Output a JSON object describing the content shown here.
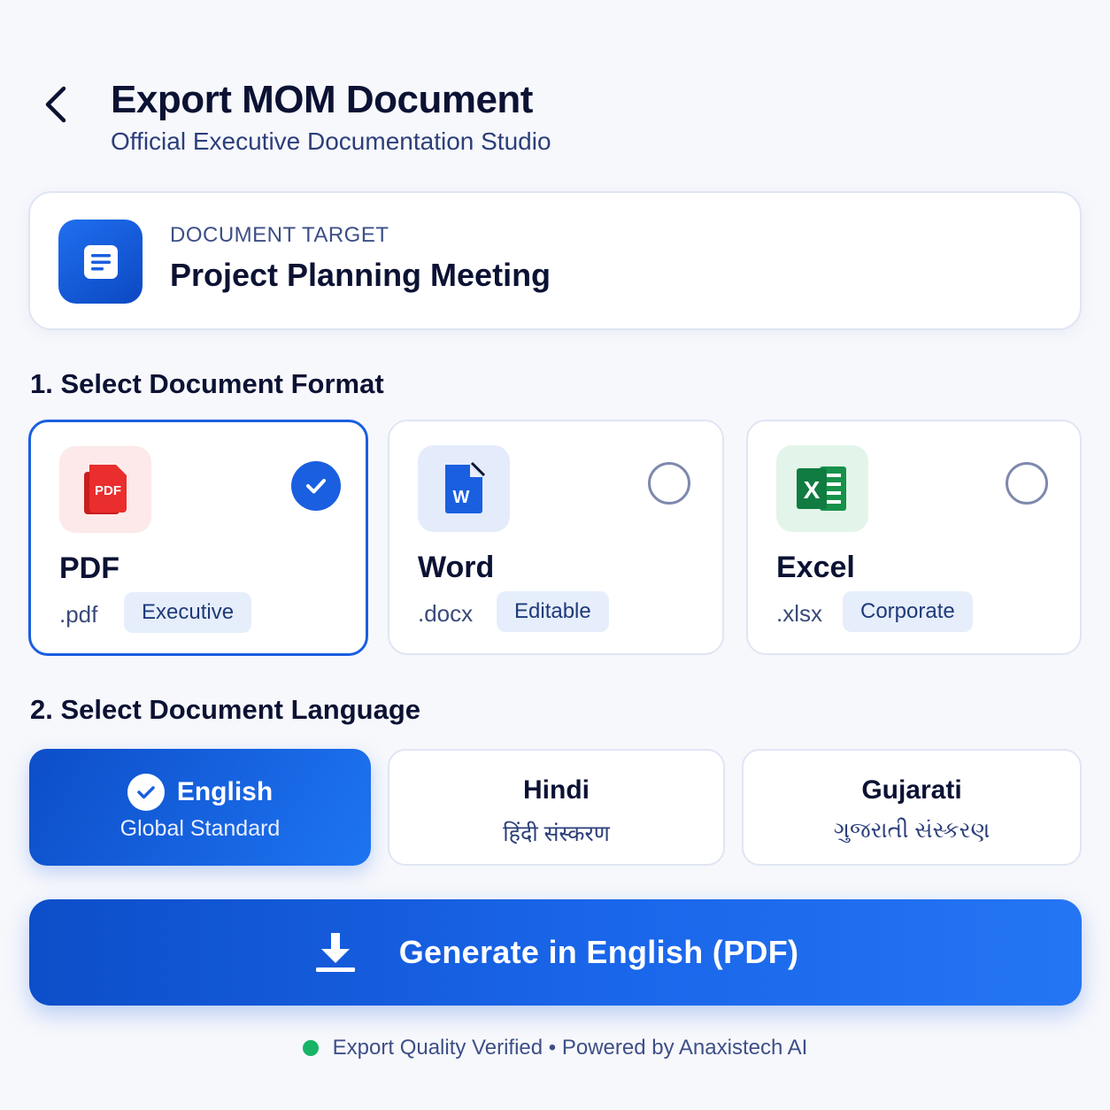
{
  "header": {
    "title": "Export MOM Document",
    "subtitle": "Official Executive Documentation Studio"
  },
  "target": {
    "label": "DOCUMENT TARGET",
    "value": "Project Planning Meeting"
  },
  "format_section": {
    "title": "1. Select Document Format",
    "options": [
      {
        "name": "PDF",
        "ext": ".pdf",
        "tag": "Executive",
        "icon": "pdf-icon",
        "selected": true,
        "icon_text": "PDF",
        "color": "#e52b2b"
      },
      {
        "name": "Word",
        "ext": ".docx",
        "tag": "Editable",
        "icon": "word-icon",
        "selected": false,
        "icon_text": "W",
        "color": "#1a5fe0"
      },
      {
        "name": "Excel",
        "ext": ".xlsx",
        "tag": "Corporate",
        "icon": "excel-icon",
        "selected": false,
        "icon_text": "X",
        "color": "#17924a"
      }
    ]
  },
  "language_section": {
    "title": "2. Select Document Language",
    "options": [
      {
        "name": "English",
        "sub": "Global Standard",
        "selected": true
      },
      {
        "name": "Hindi",
        "sub": "हिंदी संस्करण",
        "selected": false
      },
      {
        "name": "Gujarati",
        "sub": "ગુજરાતી સંસ્કરણ",
        "selected": false
      }
    ]
  },
  "generate_button": {
    "label": "Generate in English (PDF)",
    "icon": "download-icon"
  },
  "footer": {
    "text": "Export Quality Verified • Powered by Anaxistech AI",
    "status_color": "#18b466"
  },
  "colors": {
    "accent": "#1a5fe0",
    "text_primary": "#0b1233",
    "text_secondary": "#2c3f7a"
  }
}
